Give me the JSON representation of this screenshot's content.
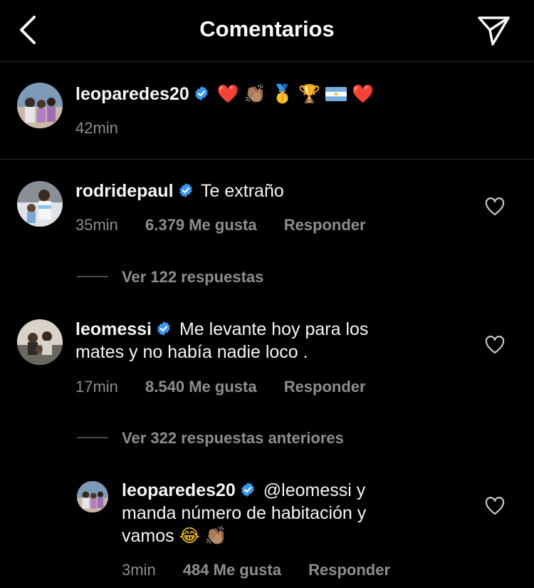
{
  "header": {
    "title": "Comentarios",
    "back_icon": "chevron-left-icon",
    "send_icon": "paper-plane-icon"
  },
  "caption": {
    "username": "leoparedes20",
    "emojis": [
      "❤️",
      "👏🏽",
      "🥇",
      "🏆",
      "🇦🇷",
      "❤️"
    ],
    "time": "42min"
  },
  "comments": [
    {
      "username": "rodridepaul",
      "text": "Te extraño",
      "time": "35min",
      "likes": "6.379 Me gusta",
      "reply": "Responder",
      "view_replies": "Ver 122 respuestas"
    },
    {
      "username": "leomessi",
      "text_line1": "Me levante hoy para los",
      "text_line2": "mates y no había nadie loco .",
      "time": "17min",
      "likes": "8.540 Me gusta",
      "reply": "Responder",
      "view_replies": "Ver 322 respuestas anteriores"
    }
  ],
  "reply": {
    "username": "leoparedes20",
    "mention": "@leomessi",
    "text_line1_rest": "y",
    "text_line2": "manda número de habitación y",
    "text_line3": "vamos",
    "emojis": [
      "😂",
      "👏🏽"
    ],
    "time": "3min",
    "likes": "484 Me gusta",
    "reply_label": "Responder"
  },
  "colors": {
    "background": "#000000",
    "text": "#f5f5f5",
    "secondary": "#8e8e8e",
    "verified": "#3897f0"
  }
}
